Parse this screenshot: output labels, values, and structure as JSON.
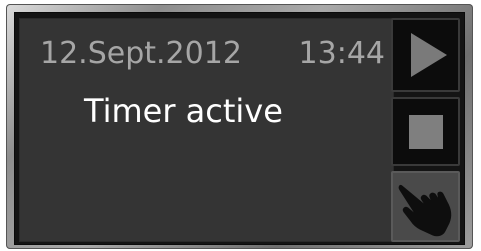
{
  "header": {
    "date": "12.Sept.2012",
    "time": "13:44"
  },
  "status": {
    "text": "Timer active"
  },
  "controls": {
    "buttons": [
      {
        "name": "play",
        "icon": "play-icon"
      },
      {
        "name": "stop",
        "icon": "stop-icon"
      },
      {
        "name": "touch",
        "icon": "hand-pointer-icon"
      }
    ]
  },
  "colors": {
    "display_background": "#343434",
    "date_time_text": "#a6a6a6",
    "status_text": "#ffffff",
    "button_background": "#0c0c0c",
    "icon_gray": "#7a7a7a"
  }
}
